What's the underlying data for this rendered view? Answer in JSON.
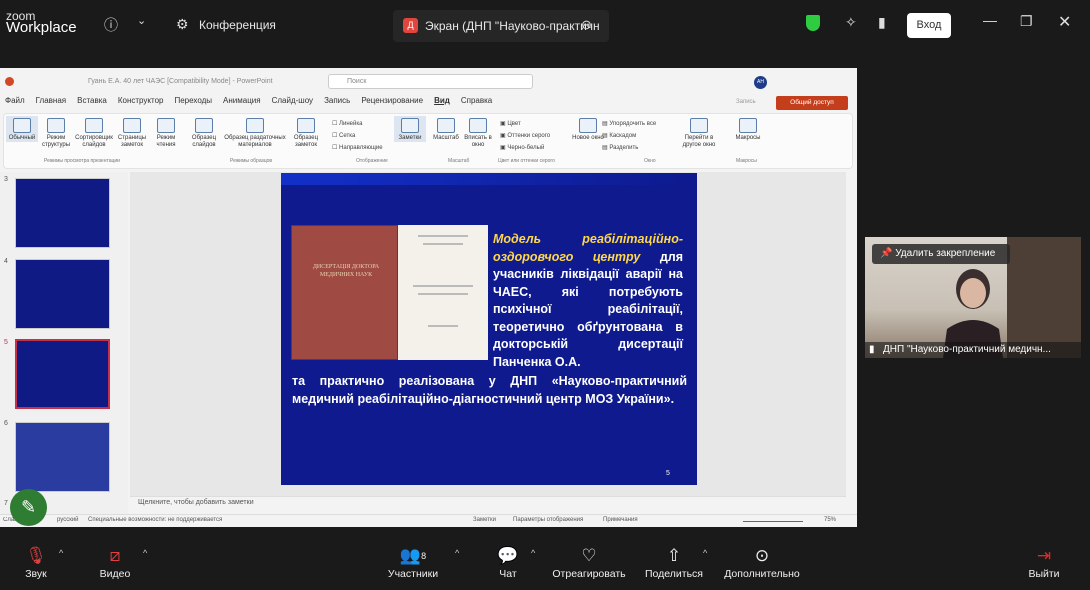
{
  "zoom": {
    "logo_line1": "zoom",
    "logo_line2": "Workplace",
    "conference_tab": "Конференция",
    "screen_tab": "Экран (ДНП \"Науково-практичн",
    "screen_tab_initial": "Д",
    "entry_button": "Вход"
  },
  "ppt": {
    "window_title": "Гуань Е.А. 40 лет ЧАЭС [Compatibility Mode] - PowerPoint",
    "search_placeholder": "Поиск",
    "avatar": "АН",
    "menu": [
      "Файл",
      "Главная",
      "Вставка",
      "Конструктор",
      "Переходы",
      "Анимация",
      "Слайд-шоу",
      "Запись",
      "Рецензирование",
      "Вид",
      "Справка"
    ],
    "record_label": "Запись",
    "share_button": "Общий доступ",
    "ribbon": {
      "views": [
        "Обычный",
        "Режим структуры",
        "Сортировщик слайдов",
        "Страницы заметок",
        "Режим чтения"
      ],
      "views_group": "Режимы просмотра презентации",
      "masters": [
        "Образец слайдов",
        "Образец раздаточных материалов",
        "Образец заметок"
      ],
      "masters_group": "Режимы образцов",
      "show": [
        "Линейка",
        "Сетка",
        "Направляющие"
      ],
      "notes": "Заметки",
      "show_group": "Отображение",
      "zoom": [
        "Масштаб",
        "Вписать в окно"
      ],
      "zoom_group": "Масштаб",
      "color": [
        "Цвет",
        "Оттенки серого",
        "Черно-белый"
      ],
      "color_group": "Цвет или оттенки серого",
      "window": [
        "Новое окно",
        "Упорядочить все",
        "Каскадом",
        "Разделить",
        "Перейти в другое окно"
      ],
      "window_group": "Окно",
      "macros": "Макросы",
      "macros_group": "Макросы"
    },
    "thumb_numbers": [
      "3",
      "4",
      "5",
      "6",
      "7"
    ],
    "slide": {
      "diss_title": "ДИСЕРТАЦІЯ ДОКТОРА МЕДИЧНИХ НАУК",
      "italic_text": "Модель реабілітаційно-оздоровчого центру",
      "text_tail": "для учасників ліквідації аварії на ЧАЕС, які потребують психічної реабілітації, теоретично обґрунтована в докторській дисертації Панченка О.А.",
      "text_bottom": "та практично реалізована у ДНП «Науково-практичний медичний реабілітаційно-діагностичний центр МОЗ України».",
      "number": "5"
    },
    "notes_placeholder": "Щелкните, чтобы добавить заметки",
    "status_left": "Слайд 5 из 17",
    "status_lang": "русский",
    "status_access": "Специальные возможности: не поддерживается",
    "status_notes": "Заметки",
    "status_display": "Параметры отображения",
    "status_comments": "Примечания",
    "zoom_level": "75%"
  },
  "video": {
    "unpin": "Удалить закрепление",
    "name": "ДНП \"Науково-практичний медичн..."
  },
  "toolbar": {
    "audio": "Звук",
    "video": "Видео",
    "participants": "Участники",
    "participants_count": "8",
    "chat": "Чат",
    "react": "Отреагировать",
    "share": "Поделиться",
    "more": "Дополнительно",
    "leave": "Выйти"
  },
  "colors": {
    "slide_bg": "#0e1a8e",
    "accent_yellow": "#ffd84a",
    "leave_red": "#e02828",
    "shield_green": "#2ecc40"
  }
}
